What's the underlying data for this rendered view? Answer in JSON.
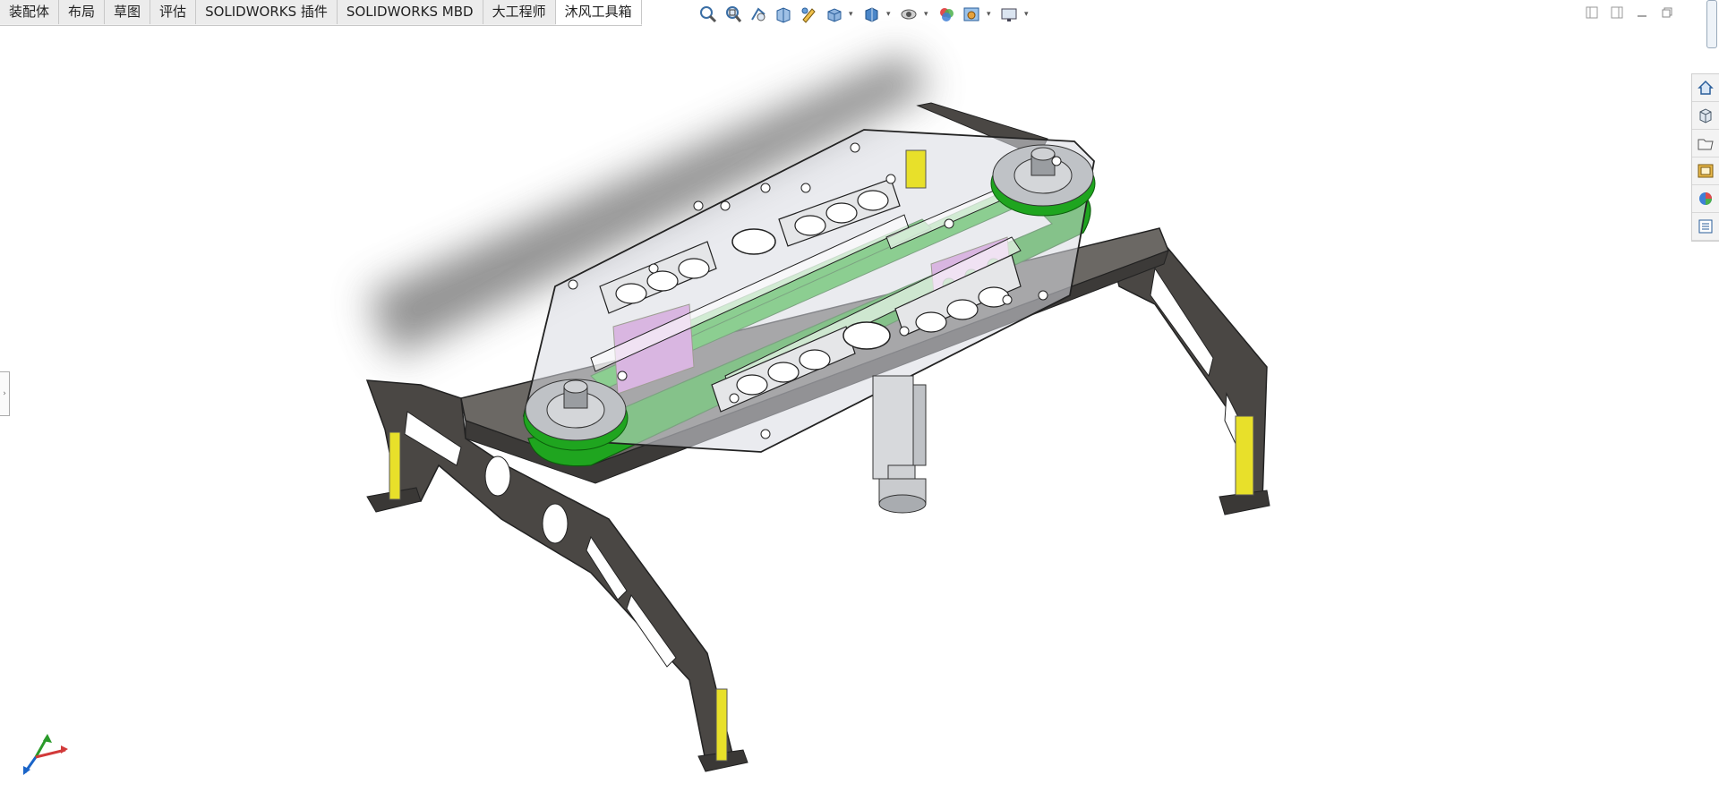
{
  "command_manager": {
    "tabs": [
      {
        "label": "装配体",
        "active": false
      },
      {
        "label": "布局",
        "active": false
      },
      {
        "label": "草图",
        "active": false
      },
      {
        "label": "评估",
        "active": false
      },
      {
        "label": "SOLIDWORKS 插件",
        "active": false
      },
      {
        "label": "SOLIDWORKS MBD",
        "active": false
      },
      {
        "label": "大工程师",
        "active": false
      },
      {
        "label": "沐风工具箱",
        "active": true
      }
    ]
  },
  "heads_up_toolbar": {
    "icons": [
      "zoom-to-fit-icon",
      "zoom-to-area-icon",
      "previous-view-icon",
      "section-view-icon",
      "dynamic-annotation-icon",
      "view-orientation-icon",
      "display-style-icon",
      "hide-show-items-icon",
      "edit-appearance-icon",
      "apply-scene-icon",
      "view-settings-icon"
    ]
  },
  "window_controls": {
    "icons": [
      "tile-left-icon",
      "tile-right-icon",
      "minimize-icon",
      "restore-icon"
    ]
  },
  "task_pane": {
    "icons": [
      "solidworks-resources-icon",
      "design-library-icon",
      "file-explorer-icon",
      "view-palette-icon",
      "appearances-scenes-icon",
      "custom-properties-icon"
    ]
  },
  "colors": {
    "frame": "#4a4744",
    "frame_dark": "#2d2b29",
    "cover": "#d8dbe2",
    "belt": "#1fa51f",
    "pink": "#d98be0",
    "yellow": "#e8e02a",
    "pulley": "#bfc2c6",
    "accent_blue": "#1a64c8"
  }
}
